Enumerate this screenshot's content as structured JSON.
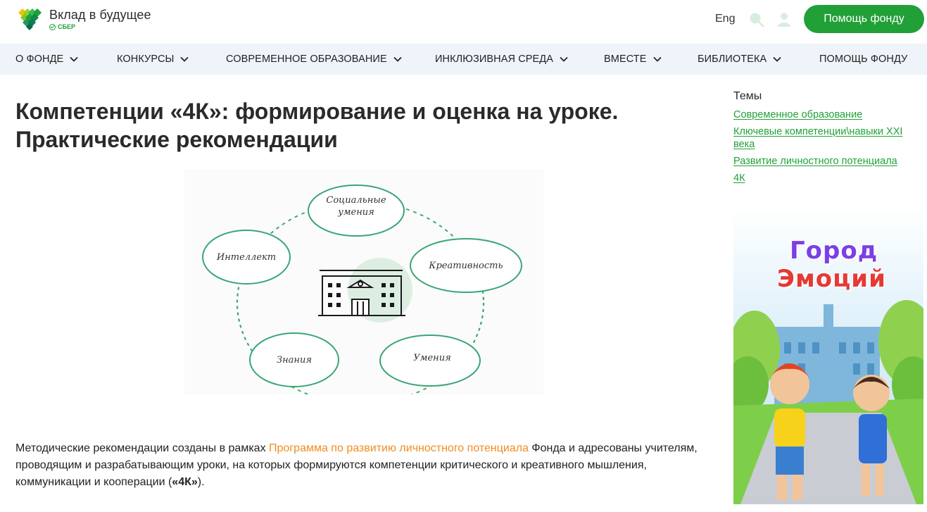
{
  "header": {
    "logo_title": "Вклад в будущее",
    "logo_sub": "СБЕР",
    "lang": "Eng",
    "help_button": "Помощь фонду"
  },
  "nav": {
    "items": [
      {
        "label": "О фонде",
        "has_dropdown": true
      },
      {
        "label": "Конкурсы",
        "has_dropdown": true
      },
      {
        "label": "Современное образование",
        "has_dropdown": true
      },
      {
        "label": "Инклюзивная среда",
        "has_dropdown": true
      },
      {
        "label": "Вместе",
        "has_dropdown": true
      },
      {
        "label": "Библиотека",
        "has_dropdown": true
      },
      {
        "label": "Помощь фонду",
        "has_dropdown": false
      }
    ]
  },
  "article": {
    "title_line1": "Компетенции «4К»: формирование и оценка на уроке.",
    "title_line2": "Практические рекомендации",
    "diagram": {
      "nodes": [
        "Социальные умения",
        "Креативность",
        "Умения",
        "Знания",
        "Интеллект"
      ]
    },
    "para_before": "Методические рекомендации созданы в рамках ",
    "para_link": "Программа по развитию личностного потенциала",
    "para_mid": " Фонда и адресованы учителям, проводящим и разрабатывающим уроки, на которых формируются компетенции критического и креативного мышления, коммуникации и кооперации (",
    "para_bold": "«4К»",
    "para_end": ")."
  },
  "sidebar": {
    "topics_title": "Темы",
    "topics": [
      "Современное образование",
      "Ключевые компетенции\\навыки XXI века",
      "Развитие личностного потенциала",
      "4К"
    ],
    "banner": {
      "line1": "Город",
      "line2": "Эмоций"
    }
  },
  "colors": {
    "brand_green": "#21a038",
    "nav_bg": "#eef4f9",
    "link_orange": "#f08d1f"
  }
}
